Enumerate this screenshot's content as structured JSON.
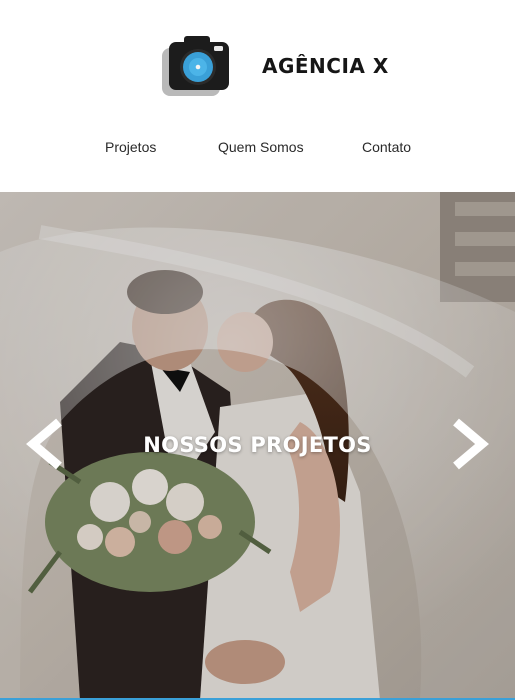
{
  "brand": {
    "name": "AGÊNCIA X",
    "logo_icon": "camera-icon",
    "accent": "#3aa0d8"
  },
  "nav": {
    "items": [
      {
        "label": "Projetos"
      },
      {
        "label": "Quem Somos"
      },
      {
        "label": "Contato"
      }
    ]
  },
  "hero": {
    "title": "NOSSOS PROJETOS",
    "prev_icon": "chevron-left-icon",
    "next_icon": "chevron-right-icon",
    "image": "wedding-couple-kissing-under-veil-photo"
  }
}
